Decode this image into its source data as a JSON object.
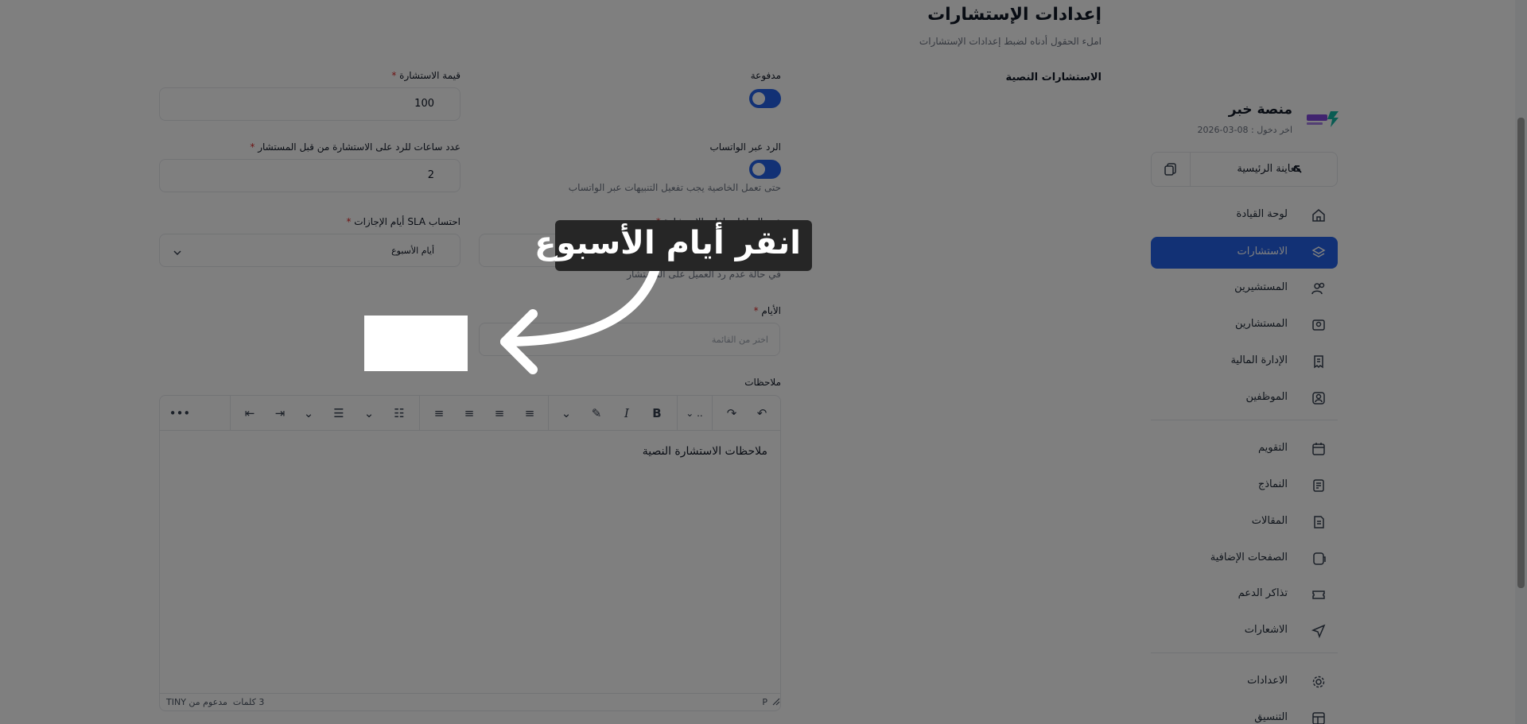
{
  "sidebar": {
    "brand_name": "منصة خبر",
    "last_login": "اخر دخول : 08-03-2026",
    "preview_label": "معاينة الرئيسية",
    "items": [
      {
        "label": "لوحة القيادة",
        "icon": "home-icon"
      },
      {
        "label": "الاستشارات",
        "icon": "layers-icon",
        "active": true
      },
      {
        "label": "المستشيرين",
        "icon": "users-icon"
      },
      {
        "label": "المستشارين",
        "icon": "user-card-icon"
      },
      {
        "label": "الإدارة المالية",
        "icon": "receipt-icon"
      },
      {
        "label": "الموظفين",
        "icon": "user-badge-icon"
      },
      {
        "label": "التقويم",
        "icon": "calendar-icon"
      },
      {
        "label": "النماذج",
        "icon": "form-icon"
      },
      {
        "label": "المقالات",
        "icon": "article-icon"
      },
      {
        "label": "الصفحات الإضافية",
        "icon": "pages-icon"
      },
      {
        "label": "تذاكر الدعم",
        "icon": "ticket-icon"
      },
      {
        "label": "الاشعارات",
        "icon": "send-icon"
      },
      {
        "label": "الاعدادات",
        "icon": "gear-icon"
      },
      {
        "label": "التنسيق",
        "icon": "layout-icon"
      }
    ]
  },
  "header": {
    "title": "إعدادات الإستشارات",
    "subtitle": "املء الحقول أدناه لضبط إعدادات الإستشارات",
    "section": "الاستشارات النصية"
  },
  "form": {
    "paid_label": "مدفوعة",
    "price_label": "قيمة الاستشارة",
    "price_value": "100",
    "whatsapp_label": "الرد عبر الواتساب",
    "whatsapp_hint": "حتى تعمل الخاصية يجب تفعيل التنبيهات عبر الواتساب",
    "hours_label": "عدد ساعات للرد على الاستشارة من قبل المستشار",
    "hours_value": "2",
    "close_label": "عدد الساعات لغلق الاستشارة",
    "close_hint": "في حالة عدم رد العميل على المستشار",
    "sla_label": "احتساب SLA أيام الإجازات",
    "sla_value": "أيام الأسبوع",
    "days_label": "الأيام",
    "days_placeholder": "اختر من القائمة",
    "notes_label": "ملاحظات"
  },
  "editor": {
    "content": "ملاحظات الاستشارة النصية",
    "word_count": "3 كلمات",
    "powered": "مدعوم من TINY",
    "path": "P"
  },
  "overlay": {
    "tooltip": "انقر أيام الأسبوع"
  },
  "colors": {
    "primary": "#2563eb",
    "required": "#dc2626"
  }
}
